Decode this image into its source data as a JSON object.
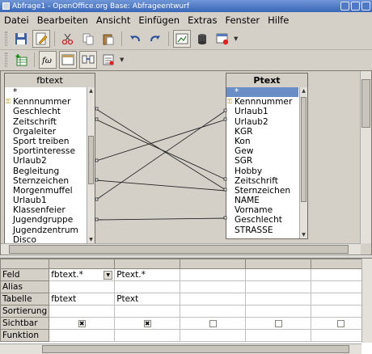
{
  "window": {
    "title": "Abfrage1 - OpenOffice.org Base: Abfrageentwurf"
  },
  "menubar": [
    "Datei",
    "Bearbeiten",
    "Ansicht",
    "Einfügen",
    "Extras",
    "Fenster",
    "Hilfe"
  ],
  "toolbar1": [
    {
      "icon": "save-icon"
    },
    {
      "icon": "edit-mode-icon"
    },
    {
      "icon": "cut-icon"
    },
    {
      "icon": "copy-icon"
    },
    {
      "icon": "paste-icon"
    },
    {
      "icon": "undo-icon"
    },
    {
      "icon": "redo-icon"
    },
    {
      "icon": "design-view-icon"
    },
    {
      "icon": "run-query-icon"
    },
    {
      "icon": "clear-query-icon"
    }
  ],
  "toolbar2": [
    {
      "icon": "add-table-icon"
    },
    {
      "icon": "functions-icon"
    },
    {
      "icon": "table-names-icon"
    },
    {
      "icon": "alias-icon"
    },
    {
      "icon": "distinct-values-icon"
    }
  ],
  "tables": {
    "left": {
      "title": "fbtext",
      "fields": [
        "*",
        "Kennnummer",
        "Geschlecht",
        "Zeitschrift",
        "Orgaleiter",
        "Sport treiben",
        "Sportinteresse",
        "Urlaub2",
        "Begleitung",
        "Sternzeichen",
        "Morgenmuffel",
        "Urlaub1",
        "Klassenfeier",
        "Jugendgruppe",
        "Jugendzentrum",
        "Disco"
      ],
      "key_field": "Kennnummer"
    },
    "right": {
      "title": "Ptext",
      "fields": [
        "*",
        "Kennnummer",
        "Urlaub1",
        "Urlaub2",
        "KGR",
        "Kon",
        "Gew",
        "SGR",
        "Hobby",
        "Zeitschrift",
        "Sternzeichen",
        "NAME",
        "Vorname",
        "Geschlecht",
        "STRASSE"
      ],
      "key_field": "Kennnummer",
      "selected_field": "*"
    }
  },
  "grid": {
    "row_labels": [
      "Feld",
      "Alias",
      "Tabelle",
      "Sortierung",
      "Sichtbar",
      "Funktion"
    ],
    "columns": [
      {
        "feld": "fbtext.*",
        "alias": "",
        "tabelle": "fbtext",
        "sortierung": "",
        "sichtbar": true,
        "funktion": ""
      },
      {
        "feld": "Ptext.*",
        "alias": "",
        "tabelle": "Ptext",
        "sortierung": "",
        "sichtbar": true,
        "funktion": ""
      },
      {
        "feld": "",
        "alias": "",
        "tabelle": "",
        "sortierung": "",
        "sichtbar": false,
        "funktion": ""
      },
      {
        "feld": "",
        "alias": "",
        "tabelle": "",
        "sortierung": "",
        "sichtbar": false,
        "funktion": ""
      },
      {
        "feld": "",
        "alias": "",
        "tabelle": "",
        "sortierung": "",
        "sichtbar": false,
        "funktion": ""
      }
    ]
  }
}
